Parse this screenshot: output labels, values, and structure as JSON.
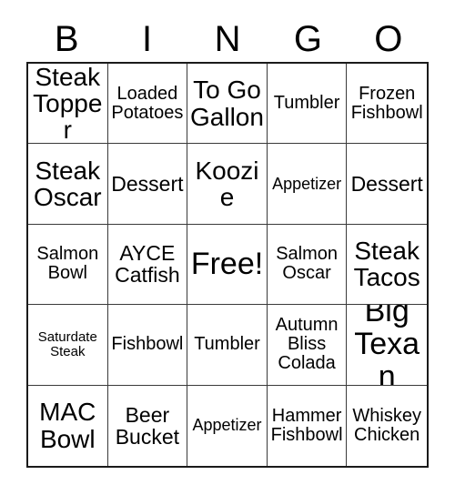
{
  "card": {
    "header_letters": [
      "B",
      "I",
      "N",
      "G",
      "O"
    ],
    "columns": 5,
    "rows": 5,
    "free_space_label": "Free!",
    "free_space_position": {
      "row": 3,
      "column": 3
    },
    "background_color": "#ffffff",
    "text_color": "#000000",
    "border_color": "#1a1a1a",
    "grid_line_color": "#3a3a3a"
  },
  "squares": [
    {
      "text": "Steak\nTopper",
      "size": "xl",
      "row": 1,
      "column": 1
    },
    {
      "text": "Loaded\nPotatoes",
      "size": "md",
      "row": 1,
      "column": 2
    },
    {
      "text": "To Go\nGallon",
      "size": "xl",
      "row": 1,
      "column": 3
    },
    {
      "text": "Tumbler",
      "size": "md",
      "row": 1,
      "column": 4
    },
    {
      "text": "Frozen\nFishbowl",
      "size": "md",
      "row": 1,
      "column": 5
    },
    {
      "text": "Steak\nOscar",
      "size": "xl",
      "row": 2,
      "column": 1
    },
    {
      "text": "Dessert",
      "size": "lg",
      "row": 2,
      "column": 2
    },
    {
      "text": "Koozie",
      "size": "xl",
      "row": 2,
      "column": 3
    },
    {
      "text": "Appetizer",
      "size": "sm",
      "row": 2,
      "column": 4
    },
    {
      "text": "Dessert",
      "size": "lg",
      "row": 2,
      "column": 5
    },
    {
      "text": "Salmon\nBowl",
      "size": "md",
      "row": 3,
      "column": 1
    },
    {
      "text": "AYCE\nCatfish",
      "size": "lg",
      "row": 3,
      "column": 2
    },
    {
      "text": "Free!",
      "size": "xxl",
      "row": 3,
      "column": 3
    },
    {
      "text": "Salmon\nOscar",
      "size": "md",
      "row": 3,
      "column": 4
    },
    {
      "text": "Steak\nTacos",
      "size": "xl",
      "row": 3,
      "column": 5
    },
    {
      "text": "Saturdate\nSteak",
      "size": "xs",
      "row": 4,
      "column": 1
    },
    {
      "text": "Fishbowl",
      "size": "md",
      "row": 4,
      "column": 2
    },
    {
      "text": "Tumbler",
      "size": "md",
      "row": 4,
      "column": 3
    },
    {
      "text": "Autumn\nBliss\nColada",
      "size": "md",
      "row": 4,
      "column": 4
    },
    {
      "text": "Big\nTexan",
      "size": "xxl",
      "row": 4,
      "column": 5
    },
    {
      "text": "MAC\nBowl",
      "size": "xl",
      "row": 5,
      "column": 1
    },
    {
      "text": "Beer\nBucket",
      "size": "lg",
      "row": 5,
      "column": 2
    },
    {
      "text": "Appetizer",
      "size": "sm",
      "row": 5,
      "column": 3
    },
    {
      "text": "Hammer\nFishbowl",
      "size": "md",
      "row": 5,
      "column": 4
    },
    {
      "text": "Whiskey\nChicken",
      "size": "md",
      "row": 5,
      "column": 5
    }
  ]
}
